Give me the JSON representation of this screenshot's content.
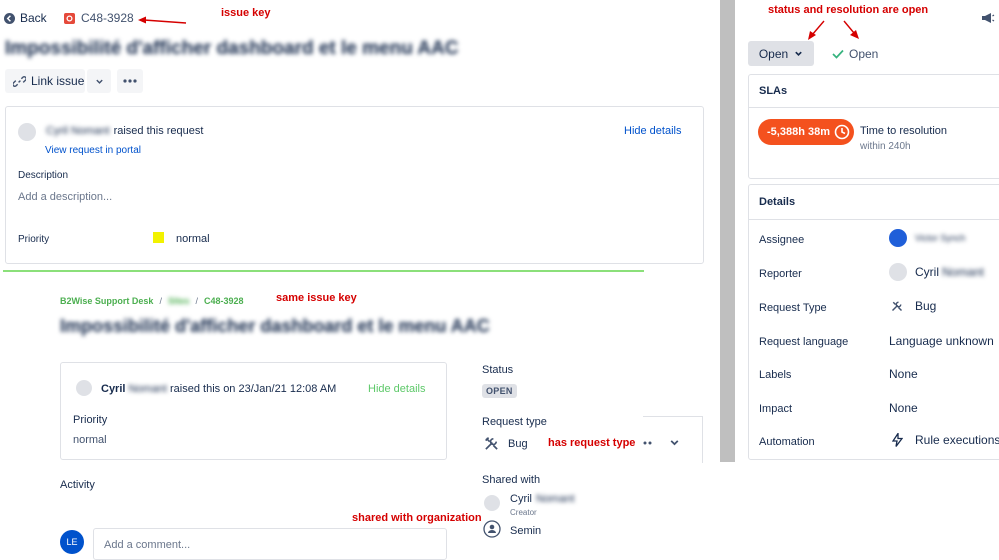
{
  "top": {
    "back_label": "Back",
    "issue_key": "C48-3928",
    "title": "Impossibilité d'afficher dashboard et le menu AAC",
    "link_issue_label": "Link issue"
  },
  "request_card": {
    "reporter_name": "Cyril Nomant",
    "raised_text": "raised this request",
    "view_portal_label": "View request in portal",
    "hide_details_label": "Hide details",
    "description_label": "Description",
    "description_placeholder": "Add a description...",
    "priority_label": "Priority",
    "priority_value": "normal",
    "priority_color": "#f2f200"
  },
  "portal": {
    "breadcrumb": [
      "B2Wise Support Desk",
      "Sites",
      "C48-3928"
    ],
    "title": "Impossibilité d'afficher dashboard et le menu AAC",
    "reporter_first": "Cyril",
    "reporter_last": "Nomant",
    "raised_on": "raised this on 23/Jan/21 12:08 AM",
    "hide_details_label": "Hide details",
    "priority_label": "Priority",
    "priority_value": "normal",
    "activity_label": "Activity",
    "comment_placeholder": "Add a comment...",
    "commenter_initials": "LE",
    "status_label": "Status",
    "status_value": "OPEN",
    "request_type_label": "Request type",
    "request_type_value": "Bug",
    "shared_with_label": "Shared with",
    "shared": [
      {
        "name": "Cyril",
        "name_blur": "Nomant",
        "role": "Creator"
      },
      {
        "name": "Semin",
        "name_blur": "",
        "role": ""
      }
    ]
  },
  "right": {
    "status_button": "Open",
    "resolution": "Open",
    "slas_title": "SLAs",
    "sla_time": "-5,388h 38m",
    "sla_name": "Time to resolution",
    "sla_target": "within 240h",
    "details_title": "Details",
    "details": [
      {
        "label": "Assignee",
        "value": "Victor Synch",
        "blur": true,
        "icon": "avatar"
      },
      {
        "label": "Reporter",
        "value": "Cyril",
        "value_blur": "Nomant",
        "icon": "avatar"
      },
      {
        "label": "Request Type",
        "value": "Bug",
        "icon": "tools-icon"
      },
      {
        "label": "Request language",
        "value": "Language unknown",
        "icon": ""
      },
      {
        "label": "Labels",
        "value": "None",
        "muted": true,
        "icon": ""
      },
      {
        "label": "Impact",
        "value": "None",
        "muted": true,
        "icon": ""
      },
      {
        "label": "Automation",
        "value": "Rule executions",
        "icon": "bolt-icon"
      }
    ]
  },
  "annotations": {
    "issue_key": "issue key",
    "status_resolution": "status and resolution are open",
    "same_issue_key": "same issue key",
    "has_request_type": "has request type",
    "shared_with_org": "shared with organization"
  },
  "colors": {
    "sla_breached": "#f4511e",
    "link": "#0052cc",
    "annotation": "#d50000",
    "green_line": "#8be07a",
    "divider_gray": "#bfbfbf"
  }
}
